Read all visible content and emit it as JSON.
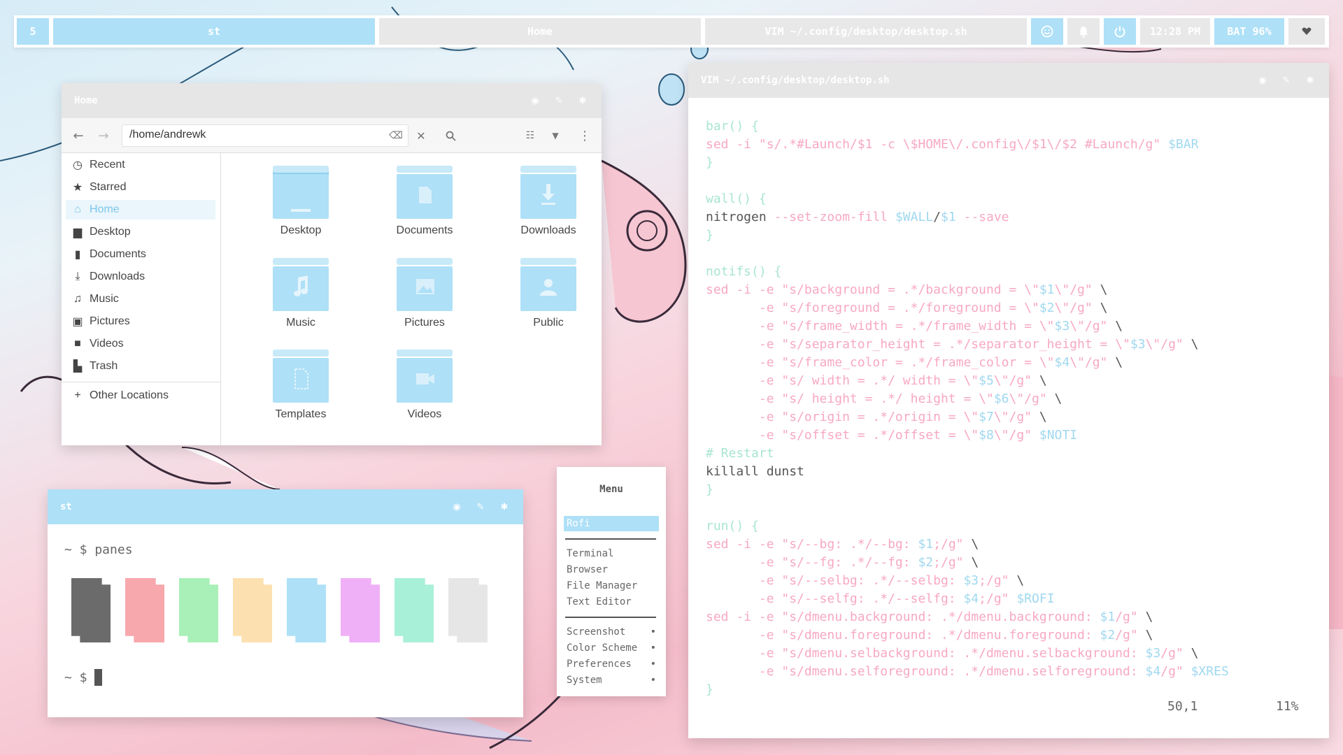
{
  "colors": {
    "accent_blue": "#aee0f7",
    "panel_grey": "#e8e8e8",
    "pink": "#f7a8c4",
    "mint": "#a8e6cf",
    "sky": "#a0d8f0"
  },
  "topbar": {
    "workspace": "5",
    "window_st": "st",
    "window_home": "Home",
    "window_vim": "VIM ~/.config/desktop/desktop.sh",
    "icons": [
      "smiley-icon",
      "bell-icon",
      "power-icon"
    ],
    "clock": "12:28 PM",
    "battery": "BAT 96%",
    "menu_icon": "heart-dropdown-icon"
  },
  "file_manager": {
    "title": "Home",
    "path": "/home/andrewk",
    "sidebar": [
      {
        "label": "Recent",
        "icon": "clock-icon"
      },
      {
        "label": "Starred",
        "icon": "star-icon"
      },
      {
        "label": "Home",
        "icon": "home-icon",
        "active": true
      },
      {
        "label": "Desktop",
        "icon": "desktop-icon"
      },
      {
        "label": "Documents",
        "icon": "document-icon"
      },
      {
        "label": "Downloads",
        "icon": "download-icon"
      },
      {
        "label": "Music",
        "icon": "music-icon"
      },
      {
        "label": "Pictures",
        "icon": "picture-icon"
      },
      {
        "label": "Videos",
        "icon": "video-icon"
      },
      {
        "label": "Trash",
        "icon": "trash-icon"
      }
    ],
    "other_locations": "Other Locations",
    "folders": [
      {
        "label": "Desktop",
        "icon": "desktop-folder-icon"
      },
      {
        "label": "Documents",
        "icon": "documents-folder-icon"
      },
      {
        "label": "Downloads",
        "icon": "downloads-folder-icon"
      },
      {
        "label": "Music",
        "icon": "music-folder-icon"
      },
      {
        "label": "Pictures",
        "icon": "pictures-folder-icon"
      },
      {
        "label": "Public",
        "icon": "public-folder-icon"
      },
      {
        "label": "Templates",
        "icon": "templates-folder-icon"
      },
      {
        "label": "Videos",
        "icon": "videos-folder-icon"
      }
    ]
  },
  "terminal": {
    "title": "st",
    "prompt1": "~ $ panes",
    "prompt2": "~ $",
    "swatches": [
      "#6b6b6b",
      "#f7a8ad",
      "#a8f0b8",
      "#fde0b0",
      "#aee0f7",
      "#f0b0f7",
      "#a8f0d8",
      "#e6e6e6"
    ]
  },
  "menu": {
    "title": "Menu",
    "selected": "Rofi",
    "group1": [
      "Terminal",
      "Browser",
      "File Manager",
      "Text Editor"
    ],
    "group2": [
      "Screenshot",
      "Color Scheme",
      "Preferences",
      "System"
    ],
    "bullet": "•"
  },
  "vim": {
    "title": "VIM ~/.config/desktop/desktop.sh",
    "lines": [
      [
        [
          "bar() {",
          "k"
        ]
      ],
      [
        [
          "sed -i ",
          "p"
        ],
        [
          "\"s/.*#Launch/$1 -c \\$HOME\\/.config\\/$1\\/$2 #Launch/g\" ",
          "s"
        ],
        [
          "$BAR",
          "v"
        ]
      ],
      [
        [
          "}",
          "k"
        ]
      ],
      [],
      [
        [
          "wall() {",
          "k"
        ]
      ],
      [
        [
          "nitrogen ",
          "d"
        ],
        [
          "--set-zoom-fill ",
          "p"
        ],
        [
          "$WALL",
          "v"
        ],
        [
          "/",
          "d"
        ],
        [
          "$1 ",
          "v"
        ],
        [
          "--save",
          "p"
        ]
      ],
      [
        [
          "}",
          "k"
        ]
      ],
      [],
      [
        [
          "notifs() {",
          "k"
        ]
      ],
      [
        [
          "sed -i -e ",
          "p"
        ],
        [
          "\"s/background = .*/background = \\\"",
          "s"
        ],
        [
          "$1",
          "v"
        ],
        [
          "\\\"/g\" ",
          "s"
        ],
        [
          "\\",
          "d"
        ]
      ],
      [
        [
          "       -e ",
          "p"
        ],
        [
          "\"s/foreground = .*/foreground = \\\"",
          "s"
        ],
        [
          "$2",
          "v"
        ],
        [
          "\\\"/g\" ",
          "s"
        ],
        [
          "\\",
          "d"
        ]
      ],
      [
        [
          "       -e ",
          "p"
        ],
        [
          "\"s/frame_width = .*/frame_width = \\\"",
          "s"
        ],
        [
          "$3",
          "v"
        ],
        [
          "\\\"/g\" ",
          "s"
        ],
        [
          "\\",
          "d"
        ]
      ],
      [
        [
          "       -e ",
          "p"
        ],
        [
          "\"s/separator_height = .*/separator_height = \\\"",
          "s"
        ],
        [
          "$3",
          "v"
        ],
        [
          "\\\"/g\" ",
          "s"
        ],
        [
          "\\",
          "d"
        ]
      ],
      [
        [
          "       -e ",
          "p"
        ],
        [
          "\"s/frame_color = .*/frame_color = \\\"",
          "s"
        ],
        [
          "$4",
          "v"
        ],
        [
          "\\\"/g\" ",
          "s"
        ],
        [
          "\\",
          "d"
        ]
      ],
      [
        [
          "       -e ",
          "p"
        ],
        [
          "\"s/ width = .*/ width = \\\"",
          "s"
        ],
        [
          "$5",
          "v"
        ],
        [
          "\\\"/g\" ",
          "s"
        ],
        [
          "\\",
          "d"
        ]
      ],
      [
        [
          "       -e ",
          "p"
        ],
        [
          "\"s/ height = .*/ height = \\\"",
          "s"
        ],
        [
          "$6",
          "v"
        ],
        [
          "\\\"/g\" ",
          "s"
        ],
        [
          "\\",
          "d"
        ]
      ],
      [
        [
          "       -e ",
          "p"
        ],
        [
          "\"s/origin = .*/origin = \\\"",
          "s"
        ],
        [
          "$7",
          "v"
        ],
        [
          "\\\"/g\" ",
          "s"
        ],
        [
          "\\",
          "d"
        ]
      ],
      [
        [
          "       -e ",
          "p"
        ],
        [
          "\"s/offset = .*/offset = \\\"",
          "s"
        ],
        [
          "$8",
          "v"
        ],
        [
          "\\\"/g\" ",
          "s"
        ],
        [
          "$NOTI",
          "v"
        ]
      ],
      [
        [
          "# Restart",
          "c"
        ]
      ],
      [
        [
          "killall dunst",
          "d"
        ]
      ],
      [
        [
          "}",
          "k"
        ]
      ],
      [],
      [
        [
          "run() {",
          "k"
        ]
      ],
      [
        [
          "sed -i -e ",
          "p"
        ],
        [
          "\"s/--bg: .*/--bg: ",
          "s"
        ],
        [
          "$1",
          "v"
        ],
        [
          ";/g\" ",
          "s"
        ],
        [
          "\\",
          "d"
        ]
      ],
      [
        [
          "       -e ",
          "p"
        ],
        [
          "\"s/--fg: .*/--fg: ",
          "s"
        ],
        [
          "$2",
          "v"
        ],
        [
          ";/g\" ",
          "s"
        ],
        [
          "\\",
          "d"
        ]
      ],
      [
        [
          "       -e ",
          "p"
        ],
        [
          "\"s/--selbg: .*/--selbg: ",
          "s"
        ],
        [
          "$3",
          "v"
        ],
        [
          ";/g\" ",
          "s"
        ],
        [
          "\\",
          "d"
        ]
      ],
      [
        [
          "       -e ",
          "p"
        ],
        [
          "\"s/--selfg: .*/--selfg: ",
          "s"
        ],
        [
          "$4",
          "v"
        ],
        [
          ";/g\" ",
          "s"
        ],
        [
          "$ROFI",
          "v"
        ]
      ],
      [
        [
          "sed -i -e ",
          "p"
        ],
        [
          "\"s/dmenu.background: .*/dmenu.background: ",
          "s"
        ],
        [
          "$1",
          "v"
        ],
        [
          "/g\" ",
          "s"
        ],
        [
          "\\",
          "d"
        ]
      ],
      [
        [
          "       -e ",
          "p"
        ],
        [
          "\"s/dmenu.foreground: .*/dmenu.foreground: ",
          "s"
        ],
        [
          "$2",
          "v"
        ],
        [
          "/g\" ",
          "s"
        ],
        [
          "\\",
          "d"
        ]
      ],
      [
        [
          "       -e ",
          "p"
        ],
        [
          "\"s/dmenu.selbackground: .*/dmenu.selbackground: ",
          "s"
        ],
        [
          "$3",
          "v"
        ],
        [
          "/g\" ",
          "s"
        ],
        [
          "\\",
          "d"
        ]
      ],
      [
        [
          "       -e ",
          "p"
        ],
        [
          "\"s/dmenu.selforeground: .*/dmenu.selforeground: ",
          "s"
        ],
        [
          "$4",
          "v"
        ],
        [
          "/g\" ",
          "s"
        ],
        [
          "$XRES",
          "v"
        ]
      ],
      [
        [
          "}",
          "k"
        ]
      ]
    ],
    "status_position": "50,1",
    "status_percent": "11%"
  }
}
